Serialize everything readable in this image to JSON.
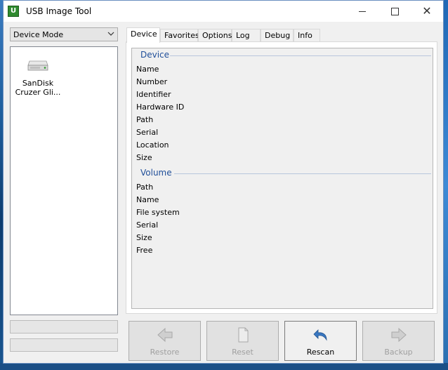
{
  "window": {
    "title": "USB Image Tool",
    "app_icon_letter": "U"
  },
  "left_panel": {
    "mode_select": {
      "value": "Device Mode"
    },
    "devices": [
      {
        "name": "SanDisk\nCruzer Gli..."
      }
    ]
  },
  "tabs": [
    {
      "label": "Device",
      "active": true
    },
    {
      "label": "Favorites",
      "active": false
    },
    {
      "label": "Options",
      "active": false
    },
    {
      "label": "Log",
      "active": false
    },
    {
      "label": "Debug",
      "active": false
    },
    {
      "label": "Info",
      "active": false
    }
  ],
  "device_tab": {
    "device_group": {
      "title": "Device",
      "fields": [
        "Name",
        "Number",
        "Identifier",
        "Hardware ID",
        "Path",
        "Serial",
        "Location",
        "Size"
      ]
    },
    "volume_group": {
      "title": "Volume",
      "fields": [
        "Path",
        "Name",
        "File system",
        "Serial",
        "Size",
        "Free"
      ]
    }
  },
  "actions": [
    {
      "label": "Restore",
      "enabled": false,
      "icon": "arrow-left-icon"
    },
    {
      "label": "Reset",
      "enabled": false,
      "icon": "document-icon"
    },
    {
      "label": "Rescan",
      "enabled": true,
      "icon": "rescan-arrow-icon"
    },
    {
      "label": "Backup",
      "enabled": false,
      "icon": "arrow-right-icon"
    }
  ],
  "colors": {
    "group_title": "#1f4e99",
    "disabled_text": "#a0a0a0",
    "rescan_icon": "#3a78c2"
  }
}
